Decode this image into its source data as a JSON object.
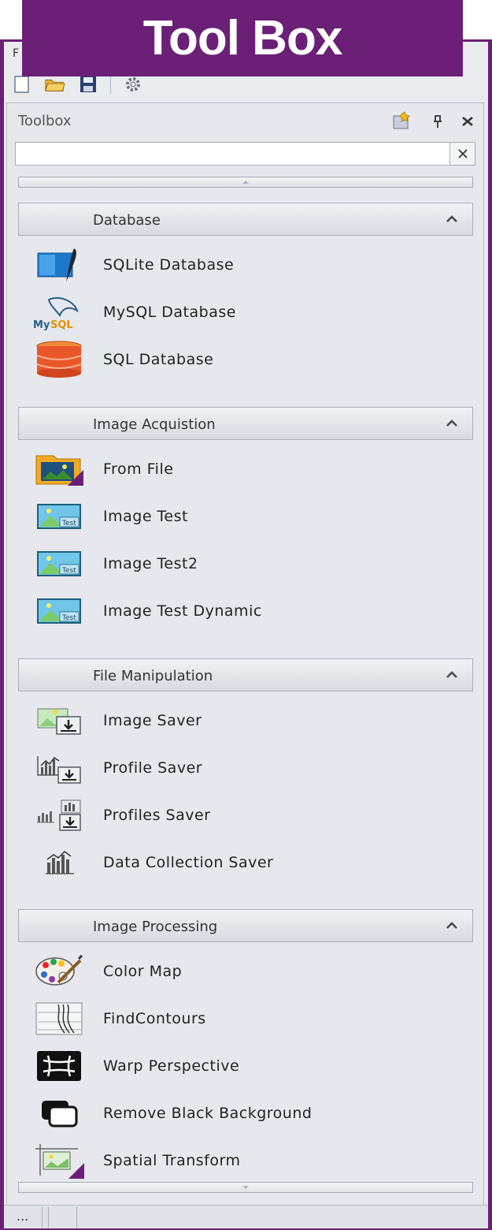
{
  "banner": {
    "title": "Tool Box"
  },
  "menu": {
    "first_letter": "F"
  },
  "toolbox": {
    "title": "Toolbox",
    "search": {
      "value": "",
      "placeholder": ""
    }
  },
  "groups": [
    {
      "title": "Database",
      "items": [
        {
          "label": "SQLite Database",
          "icon": "sqlite-icon"
        },
        {
          "label": "MySQL Database",
          "icon": "mysql-icon"
        },
        {
          "label": "SQL Database",
          "icon": "sql-database-icon"
        }
      ]
    },
    {
      "title": "Image Acquistion",
      "items": [
        {
          "label": "From File",
          "icon": "folder-image-icon"
        },
        {
          "label": "Image Test",
          "icon": "test-image-icon"
        },
        {
          "label": "Image Test2",
          "icon": "test-image-icon"
        },
        {
          "label": "Image Test Dynamic",
          "icon": "test-image-icon"
        }
      ]
    },
    {
      "title": "File Manipulation",
      "items": [
        {
          "label": "Image Saver",
          "icon": "image-saver-icon"
        },
        {
          "label": "Profile Saver",
          "icon": "profile-saver-icon"
        },
        {
          "label": "Profiles Saver",
          "icon": "profiles-saver-icon"
        },
        {
          "label": "Data Collection Saver",
          "icon": "data-collection-icon"
        }
      ]
    },
    {
      "title": "Image Processing",
      "items": [
        {
          "label": "Color Map",
          "icon": "palette-icon"
        },
        {
          "label": "FindContours",
          "icon": "contours-icon"
        },
        {
          "label": "Warp Perspective",
          "icon": "warp-icon"
        },
        {
          "label": "Remove Black Background",
          "icon": "remove-bg-icon"
        },
        {
          "label": "Spatial Transform",
          "icon": "spatial-transform-icon"
        }
      ]
    }
  ],
  "statusbar": {
    "text": "..."
  },
  "colors": {
    "brand": "#6b1f77",
    "panel": "#e6e8ed"
  }
}
